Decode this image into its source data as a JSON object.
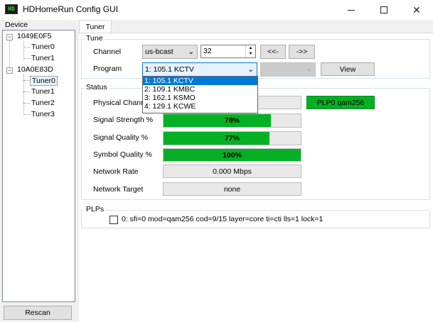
{
  "window": {
    "title": "HDHomeRun Config GUI",
    "icon_text": "HD"
  },
  "device_panel": {
    "header": "Device",
    "devices": [
      {
        "id": "1049E0F5",
        "tuners": [
          "Tuner0",
          "Tuner1"
        ]
      },
      {
        "id": "10A0E83D",
        "tuners": [
          "Tuner0",
          "Tuner1",
          "Tuner2",
          "Tuner3"
        ]
      }
    ],
    "rescan_label": "Rescan"
  },
  "tabs": [
    {
      "label": "Tuner"
    }
  ],
  "tune": {
    "group_label": "Tune",
    "channel_label": "Channel",
    "channel_map": "us-bcast",
    "channel_number": "32",
    "prev_label": "<<-",
    "next_label": "->>",
    "program_label": "Program",
    "program_selected": "1: 105.1 KCTV",
    "program_options": [
      "1: 105.1 KCTV",
      "2: 109.1 KMBC",
      "3: 162.1 KSMO",
      "4: 129.1 KCWE"
    ],
    "second_select": "",
    "view_label": "View"
  },
  "status": {
    "group_label": "Status",
    "physical_channel_label": "Physical Channel",
    "physical_channel_value": "",
    "plp_value": "PLP0 qam256",
    "signal_strength_label": "Signal Strength %",
    "signal_strength_text": "78%",
    "signal_strength": 0.78,
    "signal_quality_label": "Signal Quality %",
    "signal_quality_text": "77%",
    "signal_quality": 0.77,
    "symbol_quality_label": "Symbol Quality %",
    "symbol_quality_text": "100%",
    "symbol_quality": 1.0,
    "network_rate_label": "Network Rate",
    "network_rate_value": "0.000 Mbps",
    "network_target_label": "Network Target",
    "network_target_value": "none"
  },
  "plps": {
    "group_label": "PLPs",
    "items": [
      {
        "text": "0: sfi=0 mod=qam256 cod=9/15 layer=core ti=cti lls=1 lock=1",
        "checked": false
      }
    ]
  },
  "colors": {
    "bar_fill": "#06b025",
    "selection": "#0078d7"
  }
}
